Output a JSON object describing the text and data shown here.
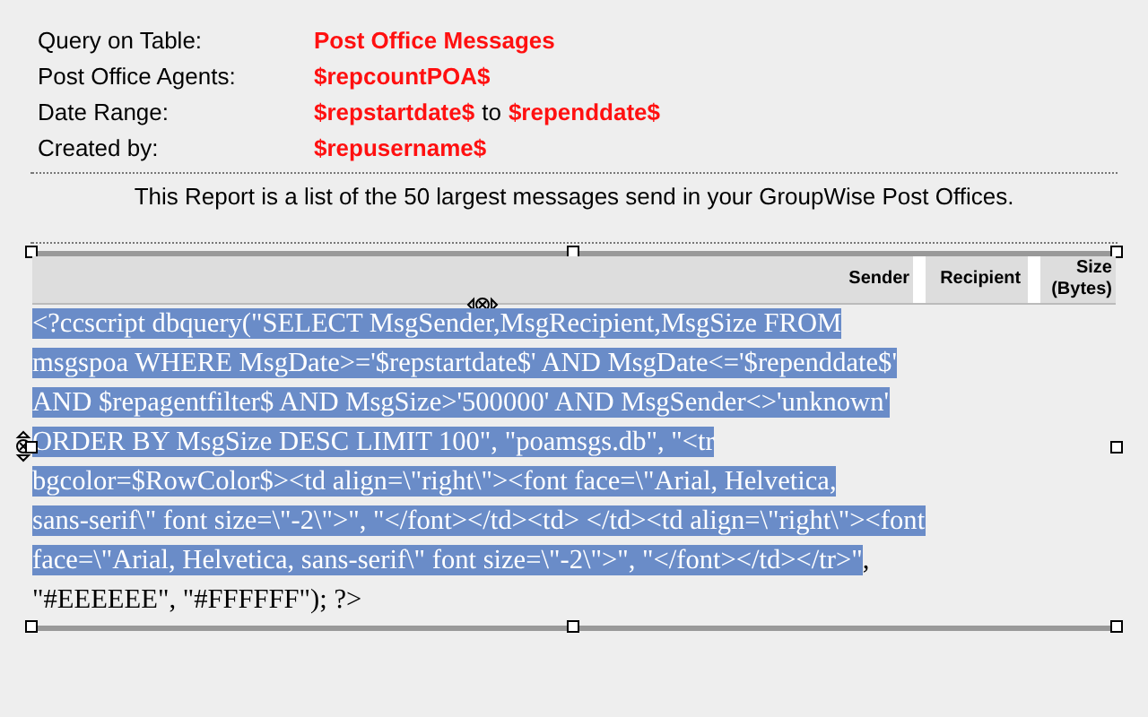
{
  "info": [
    {
      "label": "Query on Table:",
      "value": [
        {
          "text": "Post Office Messages",
          "kind": "field"
        }
      ]
    },
    {
      "label": "Post Office Agents:",
      "value": [
        {
          "text": "$repcountPOA$",
          "kind": "field"
        }
      ]
    },
    {
      "label": "Date Range:",
      "value": [
        {
          "text": "$repstartdate$",
          "kind": "field"
        },
        {
          "text": "to",
          "kind": "plain"
        },
        {
          "text": "$rependdate$",
          "kind": "field"
        }
      ]
    },
    {
      "label": "Created by:",
      "value": [
        {
          "text": "$repusername$",
          "kind": "field"
        }
      ]
    }
  ],
  "description": "This Report is a list of the 50 largest messages send in your GroupWise Post Offices.",
  "table": {
    "columns": [
      [
        "Sender"
      ],
      [
        "Recipient"
      ],
      [
        "Size",
        "(Bytes)"
      ]
    ]
  },
  "script_lines": [
    [
      {
        "text": "<?ccscript dbquery(\"SELECT MsgSender,MsgRecipient,MsgSize FROM",
        "selected": true
      }
    ],
    [
      {
        "text": "msgspoa WHERE MsgDate>='$repstartdate$' AND MsgDate<='$rependdate$'",
        "selected": true
      }
    ],
    [
      {
        "text": "AND $repagentfilter$ AND MsgSize>'500000' AND MsgSender<>'unknown'",
        "selected": true
      }
    ],
    [
      {
        "text": "ORDER BY MsgSize DESC LIMIT 100\", \"poamsgs.db\", \"<tr",
        "selected": true
      }
    ],
    [
      {
        "text": "bgcolor=$RowColor$><td align=\\\"right\\\"><font face=\\\"Arial, Helvetica,",
        "selected": true
      }
    ],
    [
      {
        "text": "sans-serif\\\" font size=\\\"-2\\\">\", \"</font></td><td> </td><td align=\\\"right\\\"><font",
        "selected": true
      }
    ],
    [
      {
        "text": "face=\\\"Arial, Helvetica, sans-serif\\\" font size=\\\"-2\\\">\", \"</font></td></tr>\"",
        "selected": true
      },
      {
        "text": ",",
        "selected": false
      }
    ],
    [
      {
        "text": "\"#EEEEEE\", \"#FFFFFF\"); ?>",
        "selected": false
      }
    ]
  ]
}
